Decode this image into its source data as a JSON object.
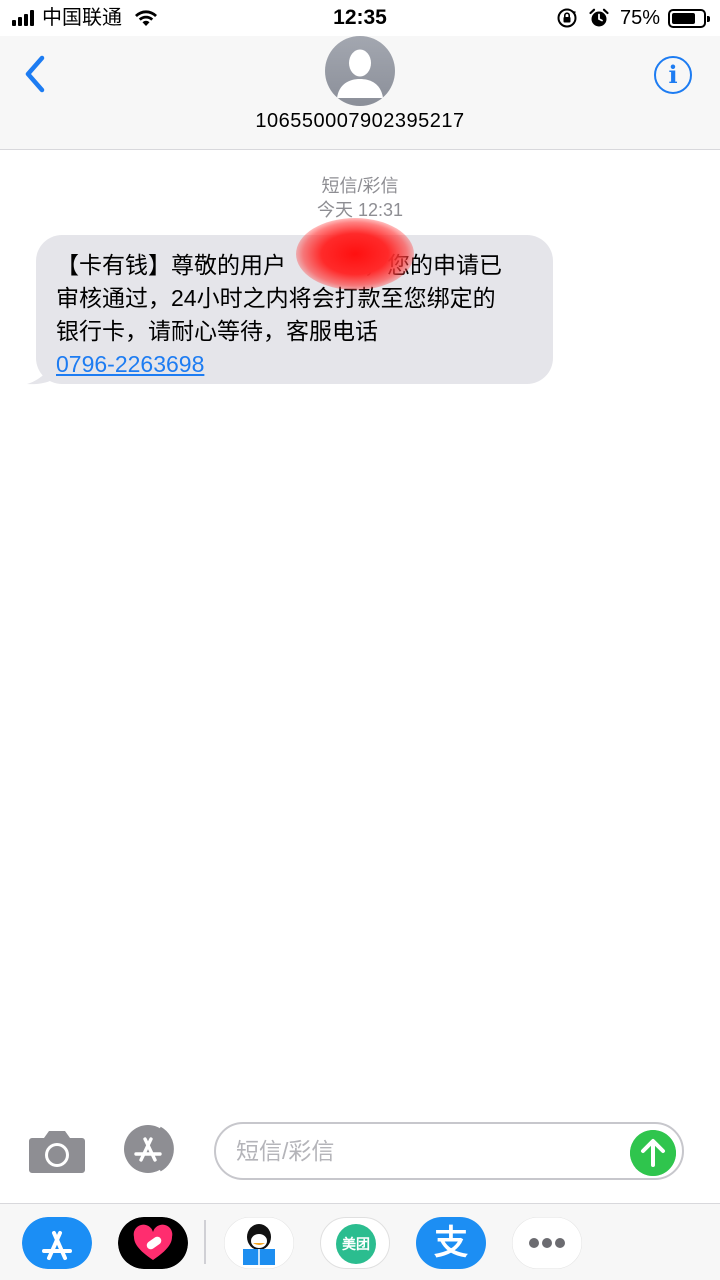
{
  "status_bar": {
    "carrier": "中国联通",
    "time": "12:35",
    "battery_percent": "75%",
    "battery_level": 0.75
  },
  "header": {
    "contact": "10655000790​2395217"
  },
  "conversation": {
    "message_type": "短信/彩信",
    "timestamp": "今天 12:31",
    "message": {
      "line1_a": "【卡有钱】尊敬的用户",
      "line1_b": "，您的申请已",
      "line2": "审核通过，24小时之内将会打款至您绑定的",
      "line3": "银行卡，请耐心等待，客服电话",
      "phone": "0796-2263698"
    }
  },
  "input": {
    "placeholder": "短信/彩信"
  },
  "app_drawer": {
    "meituan_label": "美团",
    "alipay_label": "支"
  },
  "colors": {
    "accent": "#1d7cf2",
    "send": "#2fc54d",
    "bubble": "#e5e5ea"
  }
}
